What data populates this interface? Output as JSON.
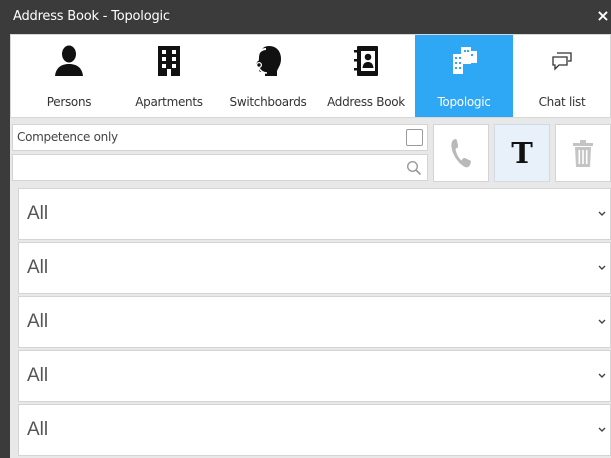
{
  "window": {
    "title": "Address Book - Topologic",
    "close_glyph": "×"
  },
  "tabs": [
    {
      "label": "Persons",
      "icon": "person-icon",
      "active": false
    },
    {
      "label": "Apartments",
      "icon": "building-icon",
      "active": false
    },
    {
      "label": "Switchboards",
      "icon": "headset-icon",
      "active": false
    },
    {
      "label": "Address Book",
      "icon": "contact-book-icon",
      "active": false
    },
    {
      "label": "Topologic",
      "icon": "topologic-buildings-icon",
      "active": true
    },
    {
      "label": "Chat list",
      "icon": "chat-icon",
      "active": false
    }
  ],
  "filters": {
    "competence_label": "Competence only",
    "competence_checked": false,
    "search_value": "",
    "search_placeholder": ""
  },
  "actions": {
    "phone": {
      "icon": "phone-icon",
      "enabled": false
    },
    "text": {
      "icon": "text-T-icon",
      "glyph": "T",
      "active": true
    },
    "trash": {
      "icon": "trash-icon",
      "enabled": false
    }
  },
  "dropdowns": [
    {
      "value": "All"
    },
    {
      "value": "All"
    },
    {
      "value": "All"
    },
    {
      "value": "All"
    },
    {
      "value": "All"
    }
  ],
  "colors": {
    "titlebar": "#3b3b3b",
    "active_tab": "#2ea7f5",
    "text_button_bg": "#e8f1f9"
  }
}
